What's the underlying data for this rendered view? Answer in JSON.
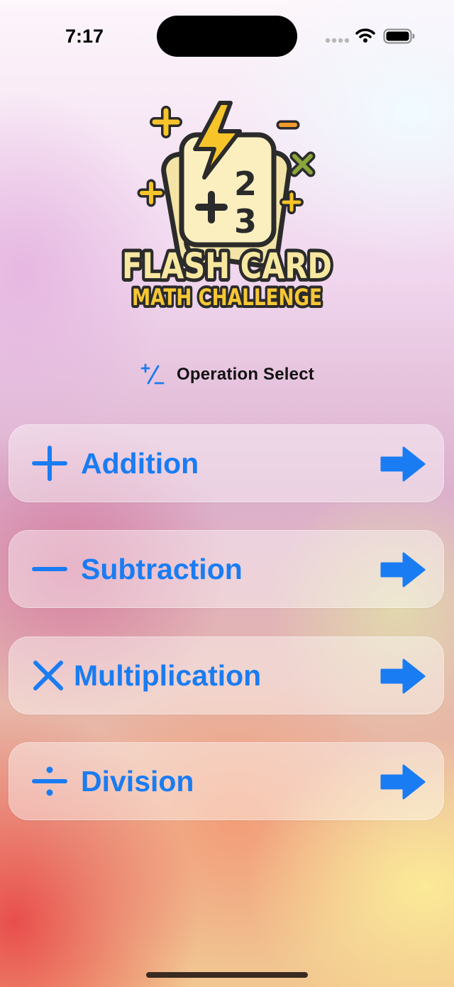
{
  "status_bar": {
    "time": "7:17"
  },
  "logo": {
    "line1": "FLASH CARD",
    "line2": "MATH CHALLENGE",
    "card_digits": [
      "2",
      "3"
    ]
  },
  "section": {
    "title": "Operation Select",
    "icon": "plus-minus-icon"
  },
  "operations": [
    {
      "label": "Addition",
      "icon": "plus-icon"
    },
    {
      "label": "Subtraction",
      "icon": "minus-icon"
    },
    {
      "label": "Multiplication",
      "icon": "multiply-icon"
    },
    {
      "label": "Division",
      "icon": "divide-icon"
    }
  ],
  "colors": {
    "accent": "#1A7CF2",
    "logo_yellow": "#F7D94C",
    "logo_outline": "#2B2B2B"
  }
}
